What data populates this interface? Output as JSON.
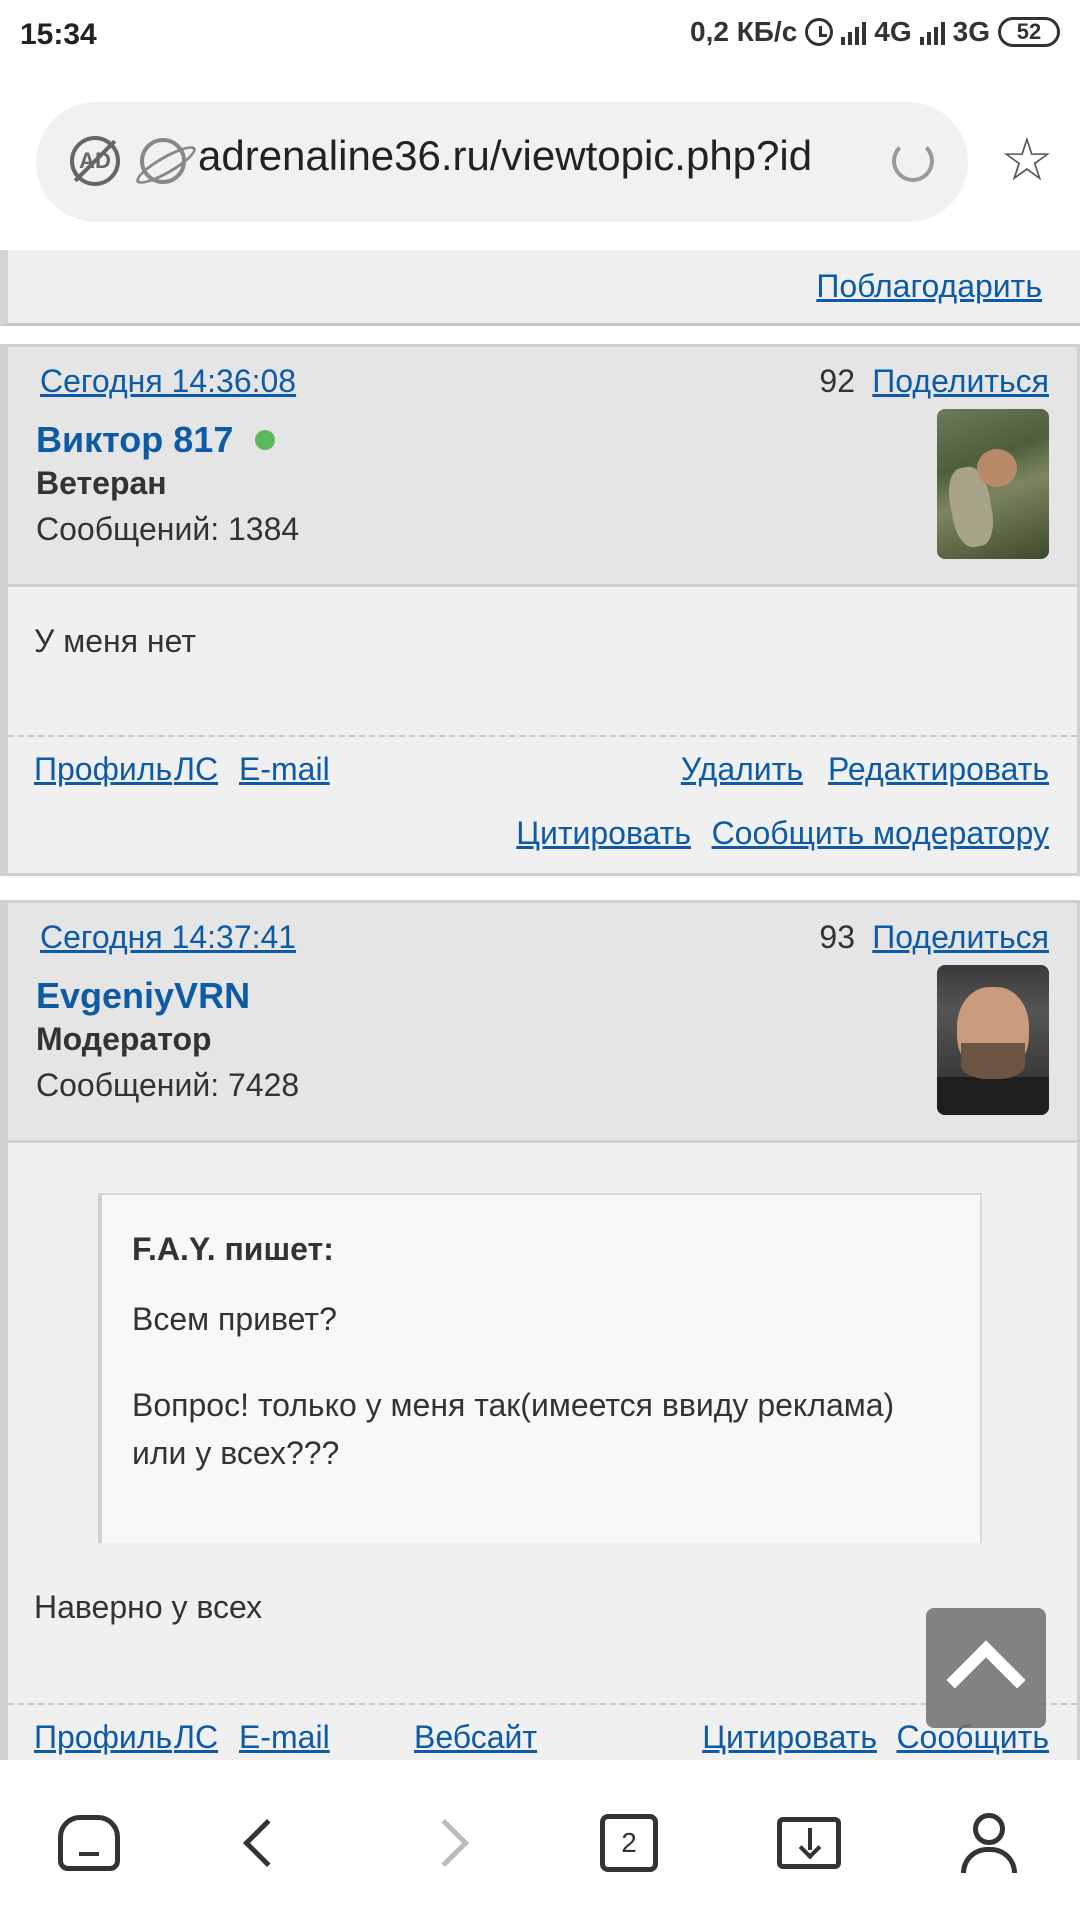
{
  "status_bar": {
    "time": "15:34",
    "speed": "0,2 КБ/с",
    "net1": "4G",
    "net2": "3G",
    "battery": "52"
  },
  "browser": {
    "url": "adrenaline36.ru/viewtopic.php?id",
    "tabs_count": "2"
  },
  "prev_post": {
    "thanks_label": "Поблагодарить"
  },
  "posts": [
    {
      "date": "Сегодня 14:36:08",
      "number": "92",
      "share_label": "Поделиться",
      "author": "Виктор 817",
      "online": true,
      "rank": "Ветеран",
      "messages": "Сообщений: 1384",
      "body": "У меня нет",
      "links": {
        "profile": "Профиль",
        "pm": "ЛС",
        "email": "E-mail",
        "delete": "Удалить",
        "edit": "Редактировать",
        "quote": "Цитировать",
        "report": "Сообщить модератору"
      }
    },
    {
      "date": "Сегодня 14:37:41",
      "number": "93",
      "share_label": "Поделиться",
      "author": "EvgeniyVRN",
      "rank": "Модератор",
      "messages": "Сообщений: 7428",
      "quote": {
        "author": "F.A.Y. пишет:",
        "line1": "Всем привет?",
        "line2": "Вопрос! только у меня так(имеется ввиду реклама) или у всех???"
      },
      "body": "Наверно у всех",
      "links": {
        "profile": "Профиль",
        "pm": "ЛС",
        "email": "E-mail",
        "website": "Вебсайт",
        "quote": "Цитировать",
        "report": "Сообщить"
      }
    }
  ]
}
